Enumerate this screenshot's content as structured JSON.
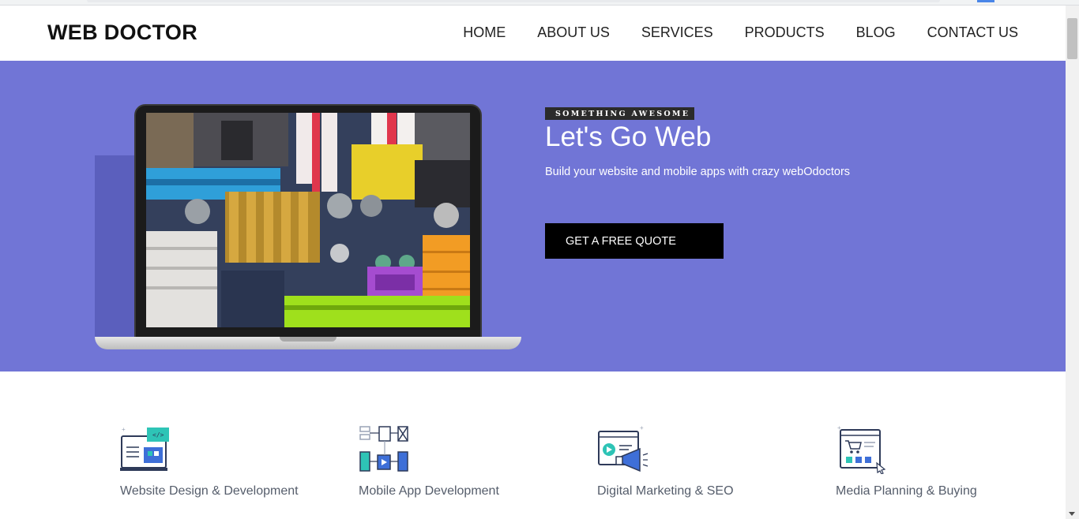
{
  "nav": {
    "brand": "WEB DOCTOR",
    "links": [
      "HOME",
      "ABOUT US",
      "SERVICES",
      "PRODUCTS",
      "BLOG",
      "CONTACT US"
    ]
  },
  "hero": {
    "eyebrow": "SOMETHING AWESOME",
    "title": "Let's Go Web",
    "subtitle": "Build your website and mobile apps with crazy webOdoctors",
    "cta": "GET A FREE QUOTE",
    "background": "#7175d6"
  },
  "services": [
    {
      "label": "Website Design & Development",
      "icon": "web-design-icon"
    },
    {
      "label": "Mobile App Development",
      "icon": "mobile-app-icon"
    },
    {
      "label": "Digital Marketing & SEO",
      "icon": "marketing-megaphone-icon"
    },
    {
      "label": "Media Planning & Buying",
      "icon": "media-cart-icon"
    }
  ]
}
